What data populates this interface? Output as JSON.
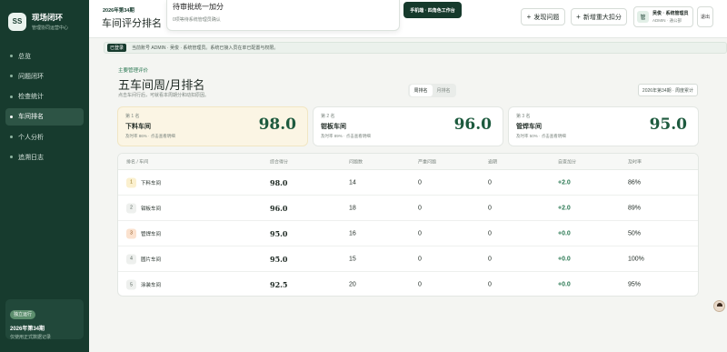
{
  "brand": {
    "logo": "SS",
    "title": "现场闭环",
    "subtitle": "管理协同运营中心"
  },
  "sidebar": {
    "items": [
      {
        "label": "总览",
        "active": false
      },
      {
        "label": "问题闭环",
        "active": false
      },
      {
        "label": "检查统计",
        "active": false
      },
      {
        "label": "车间排名",
        "active": true
      },
      {
        "label": "个人分析",
        "active": false
      },
      {
        "label": "追溯日志",
        "active": false
      }
    ],
    "card": {
      "badge": "独立运行",
      "week": "2026年第34期",
      "note": "仅使用正式数据记录"
    }
  },
  "header": {
    "week": "2026年第34期",
    "title": "车间评分排名",
    "popup": {
      "title": "待审批统一加分",
      "subtitle": "0项等待系统管理员确认"
    },
    "chip": "手机端 · 四角色工作台",
    "find_label": "发现问题",
    "add_label": "新增重大扣分",
    "user": {
      "avatar": "管",
      "name": "吴俊 · 系统管理员",
      "role": "ADMIN · 通公部"
    },
    "logout": "退出"
  },
  "notice": {
    "tag": "已登录",
    "text": "当前账号 ADMIN · 吴俊 · 系统管理员。系统已接入员在单已配置与权限。"
  },
  "main": {
    "section_label": "主要管理评价",
    "title": "五车间周/月排名",
    "subtitle": "点击车间行后，可就看本周期分和动扣原因。",
    "seg": [
      "周排名",
      "月排名"
    ],
    "week_select": "2026年第34期 · 周度累计"
  },
  "top_cards": [
    {
      "rank": "第 1 名",
      "name": "下料车间",
      "note": "及时率 86% · 点击查看明细",
      "score": "98.0"
    },
    {
      "rank": "第 2 名",
      "name": "钳板车间",
      "note": "及时率 89% · 点击查看明细",
      "score": "96.0"
    },
    {
      "rank": "第 3 名",
      "name": "管焊车间",
      "note": "及时率 50% · 点击查看明细",
      "score": "95.0"
    }
  ],
  "table": {
    "headers": [
      "排名 / 车间",
      "综合得分",
      "问题数",
      "严重问题",
      "逾期",
      "自查加分",
      "及时率"
    ],
    "rows": [
      {
        "rank": "1",
        "name": "下料车间",
        "score": "98.0",
        "issues": "14",
        "severe": "0",
        "overdue": "0",
        "bonus": "+2.0",
        "rate": "86%"
      },
      {
        "rank": "2",
        "name": "钳板车间",
        "score": "96.0",
        "issues": "18",
        "severe": "0",
        "overdue": "0",
        "bonus": "+2.0",
        "rate": "89%"
      },
      {
        "rank": "3",
        "name": "管焊车间",
        "score": "95.0",
        "issues": "16",
        "severe": "0",
        "overdue": "0",
        "bonus": "+0.0",
        "rate": "50%"
      },
      {
        "rank": "4",
        "name": "圆片车间",
        "score": "95.0",
        "issues": "15",
        "severe": "0",
        "overdue": "0",
        "bonus": "+0.0",
        "rate": "100%"
      },
      {
        "rank": "5",
        "name": "涂装车间",
        "score": "92.5",
        "issues": "20",
        "severe": "0",
        "overdue": "0",
        "bonus": "+0.0",
        "rate": "95%"
      }
    ]
  }
}
